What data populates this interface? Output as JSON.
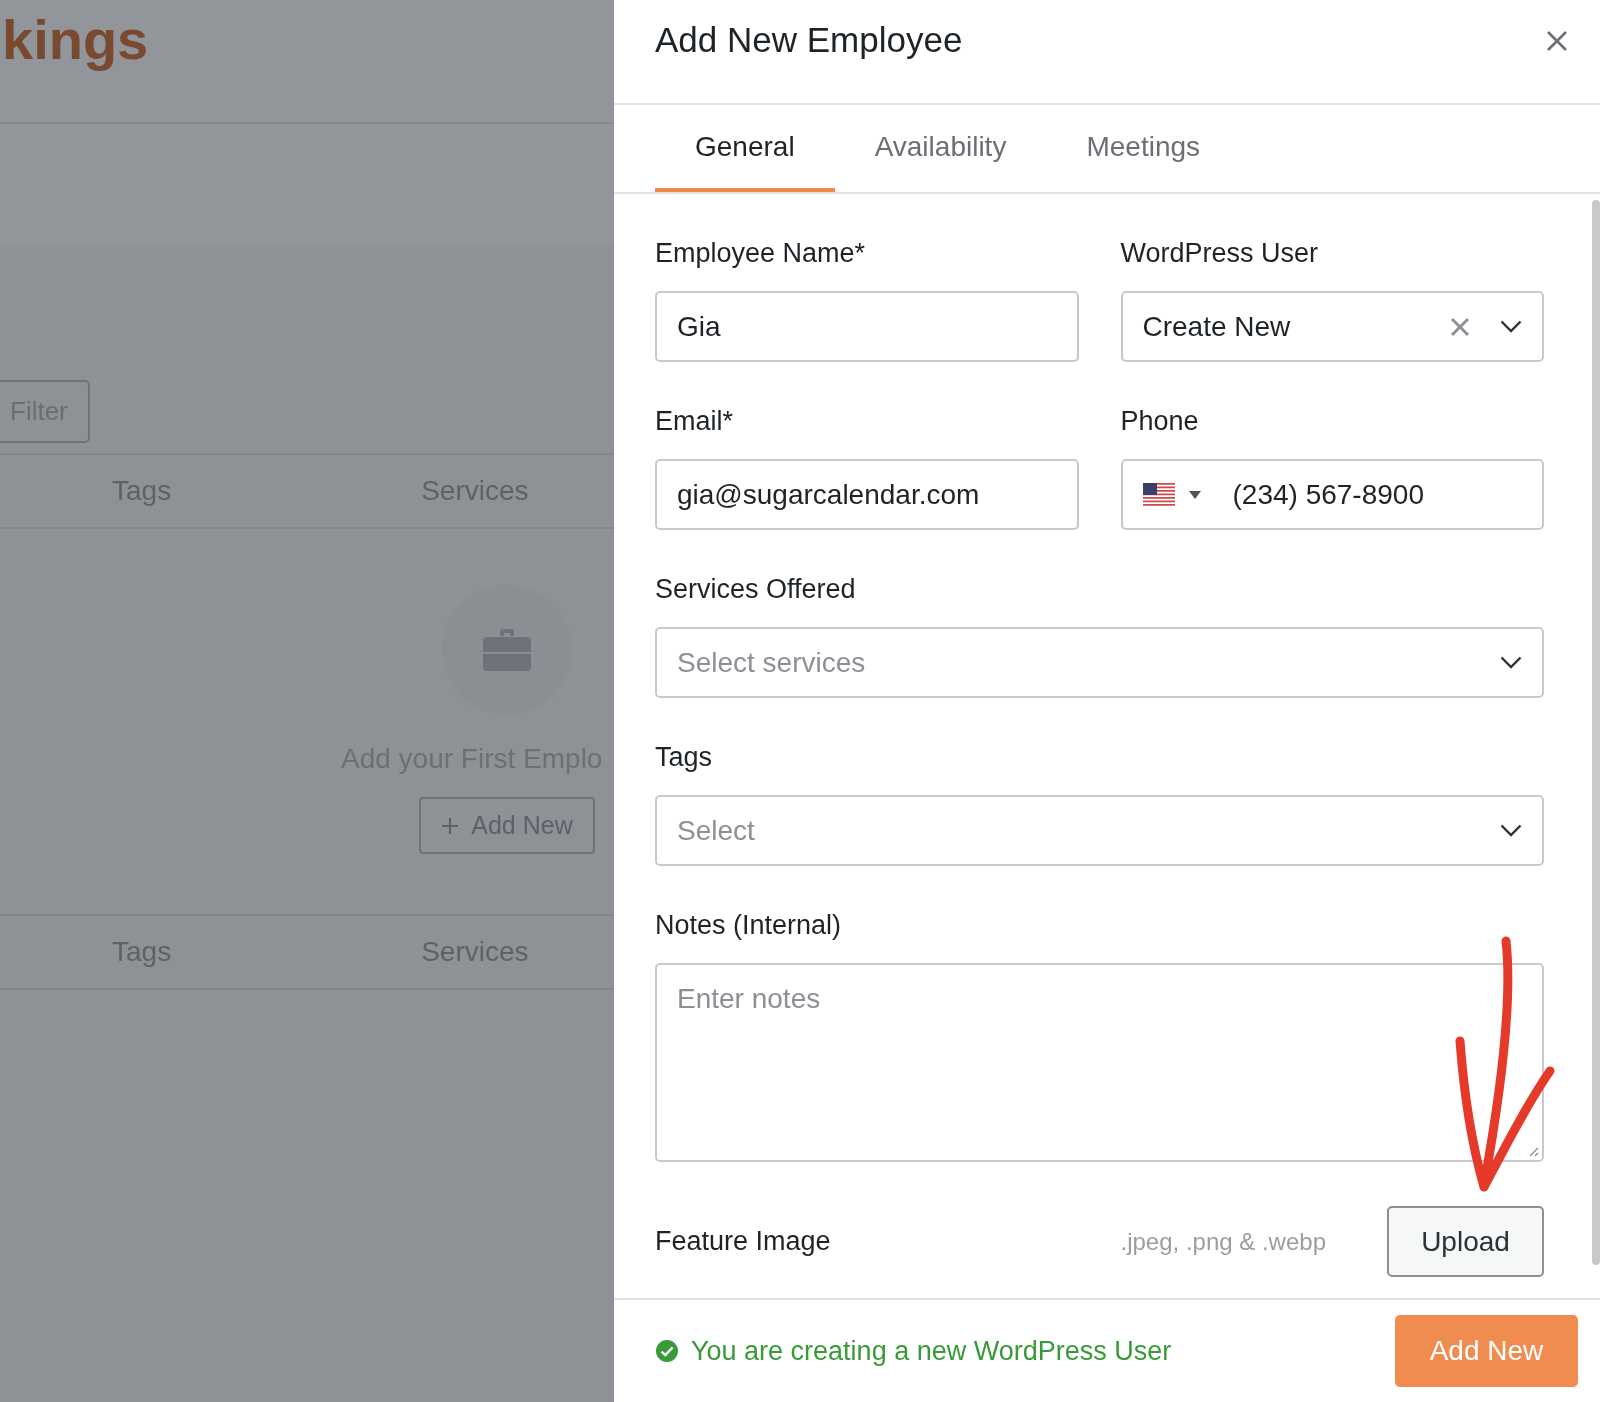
{
  "background": {
    "logo": "kings",
    "filter_button": "Filter",
    "table_header_top": [
      "Tags",
      "Services"
    ],
    "empty_state": {
      "message": "Add your First Emplo",
      "button": "Add New"
    },
    "table_header_bottom": [
      "Tags",
      "Services"
    ]
  },
  "panel": {
    "title": "Add New Employee",
    "tabs": [
      {
        "label": "General",
        "selected": true
      },
      {
        "label": "Availability",
        "selected": false
      },
      {
        "label": "Meetings",
        "selected": false
      }
    ],
    "rows": [
      [
        {
          "kind": "text",
          "label": "Employee Name*",
          "value": "Gia"
        },
        {
          "kind": "select",
          "label": "WordPress User",
          "value": "Create New",
          "clearable": true
        }
      ],
      [
        {
          "kind": "text",
          "label": "Email*",
          "value": "gia@sugarcalendar.com"
        },
        {
          "kind": "phone",
          "label": "Phone",
          "value": "(234) 567-8900"
        }
      ],
      [
        {
          "kind": "select",
          "label": "Services Offered",
          "placeholder": "Select services",
          "clearable": false
        }
      ],
      [
        {
          "kind": "select",
          "label": "Tags",
          "placeholder": "Select",
          "clearable": false
        }
      ],
      [
        {
          "kind": "textarea",
          "label": "Notes (Internal)",
          "placeholder": "Enter notes"
        }
      ]
    ],
    "feature_image": {
      "label": "Feature Image",
      "hint": ".jpeg, .png & .webp",
      "button": "Upload"
    },
    "footer": {
      "status": "You are creating a new WordPress User",
      "button": "Add New"
    }
  }
}
